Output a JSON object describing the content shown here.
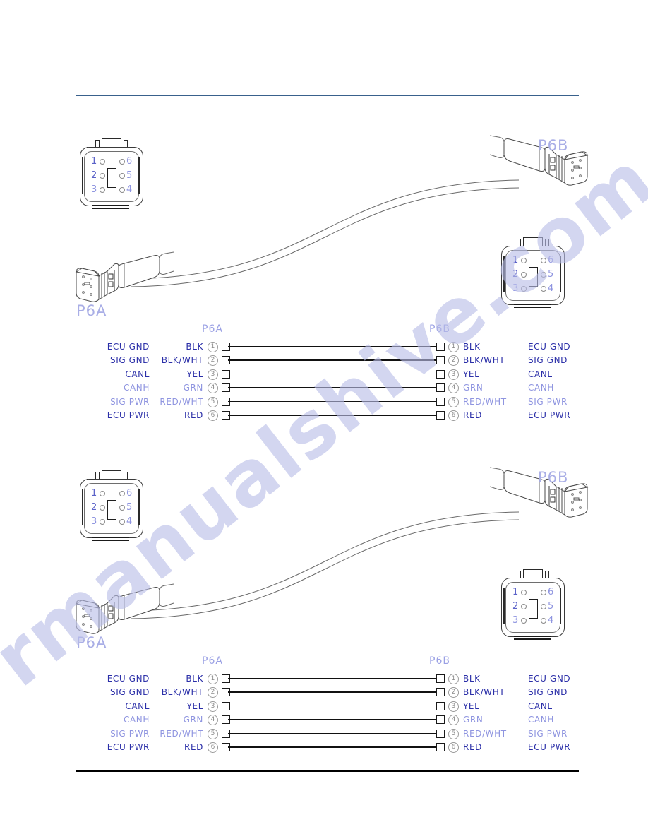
{
  "page": {
    "watermark": "rmanualshive.com",
    "rule_color_top": "#39618c",
    "rule_color_bottom": "#000000",
    "label_color": "#2b2fa8",
    "dim_label_color": "#8f95e0"
  },
  "connector": {
    "pin_numbers_left": [
      "1",
      "2",
      "3"
    ],
    "pin_numbers_right": [
      "6",
      "5",
      "4"
    ]
  },
  "diagrams": [
    {
      "plug_a_label": "P6A",
      "plug_b_label": "P6B",
      "table": {
        "head_left": "P6A",
        "head_right": "P6B",
        "rows": [
          {
            "pin": "1",
            "function": "ECU GND",
            "wire": "BLK",
            "dim": false
          },
          {
            "pin": "2",
            "function": "SIG GND",
            "wire": "BLK/WHT",
            "dim": false
          },
          {
            "pin": "3",
            "function": "CANL",
            "wire": "YEL",
            "dim": false
          },
          {
            "pin": "4",
            "function": "CANH",
            "wire": "GRN",
            "dim": true
          },
          {
            "pin": "5",
            "function": "SIG PWR",
            "wire": "RED/WHT",
            "dim": true
          },
          {
            "pin": "6",
            "function": "ECU PWR",
            "wire": "RED",
            "dim": false
          }
        ]
      }
    },
    {
      "plug_a_label": "P6A",
      "plug_b_label": "P6B",
      "table": {
        "head_left": "P6A",
        "head_right": "P6B",
        "rows": [
          {
            "pin": "1",
            "function": "ECU GND",
            "wire": "BLK",
            "dim": false
          },
          {
            "pin": "2",
            "function": "SIG GND",
            "wire": "BLK/WHT",
            "dim": false
          },
          {
            "pin": "3",
            "function": "CANL",
            "wire": "YEL",
            "dim": false
          },
          {
            "pin": "4",
            "function": "CANH",
            "wire": "GRN",
            "dim": true
          },
          {
            "pin": "5",
            "function": "SIG PWR",
            "wire": "RED/WHT",
            "dim": true
          },
          {
            "pin": "6",
            "function": "ECU PWR",
            "wire": "RED",
            "dim": false
          }
        ]
      }
    }
  ]
}
